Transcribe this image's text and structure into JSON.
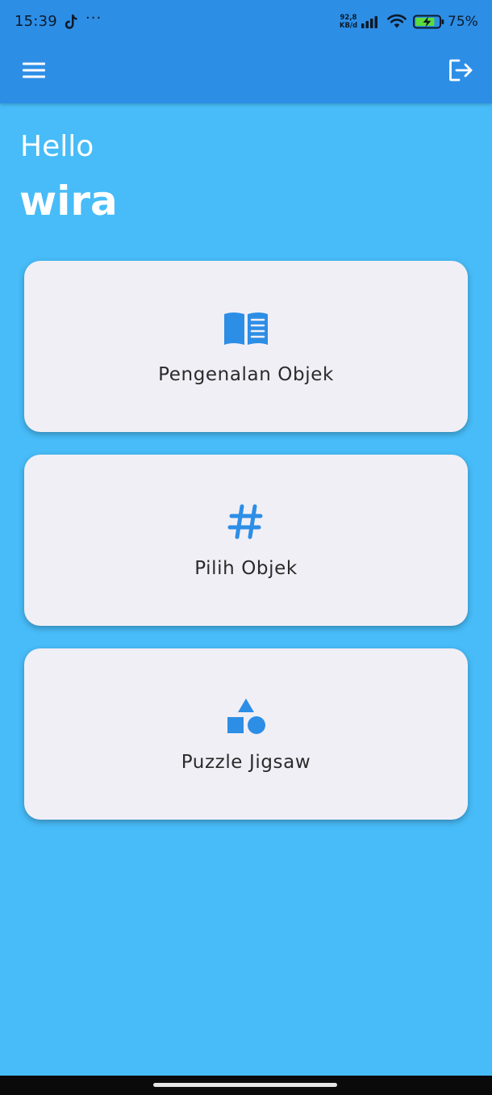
{
  "status_bar": {
    "time": "15:39",
    "dots": "···",
    "speed_value": "92,8",
    "speed_unit": "KB/d",
    "battery_percent": "75%"
  },
  "header": {
    "menu_icon": "hamburger-menu-icon",
    "logout_icon": "logout-icon"
  },
  "greeting": {
    "hello": "Hello",
    "name": "wira"
  },
  "cards": [
    {
      "label": "Pengenalan Objek",
      "icon": "book-icon"
    },
    {
      "label": "Pilih Objek",
      "icon": "hash-icon"
    },
    {
      "label": "Puzzle Jigsaw",
      "icon": "shapes-icon"
    }
  ],
  "colors": {
    "background": "#47bcf8",
    "app_bar": "#2d8ee6",
    "card": "#f1eff6",
    "icon_accent": "#2d8ee6"
  }
}
